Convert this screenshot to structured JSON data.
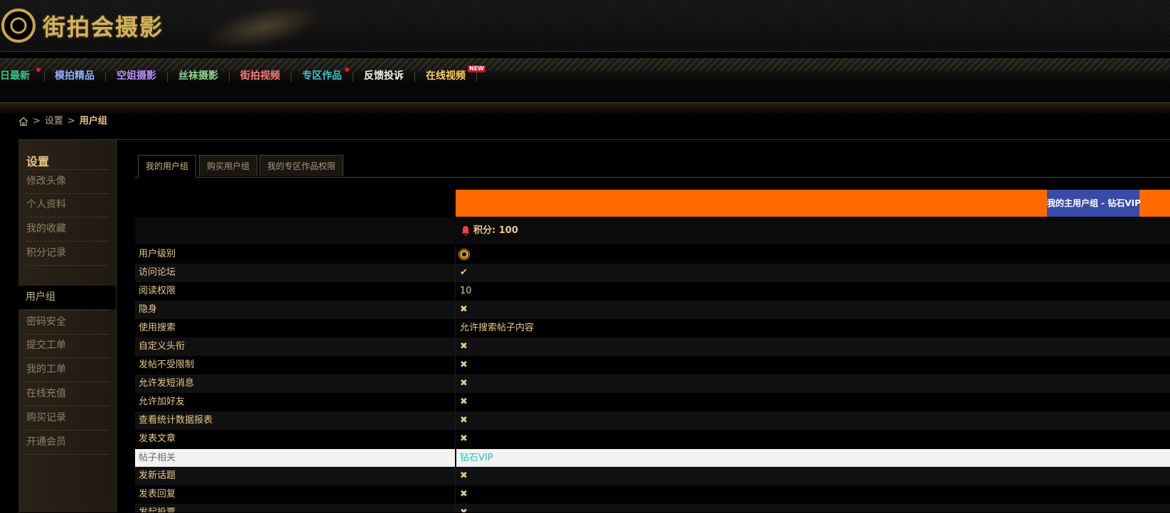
{
  "header": {
    "logo_text": "街拍会摄影"
  },
  "nav": {
    "items": [
      {
        "label": "今日最新",
        "color": "#33c98a"
      },
      {
        "label": "模拍精品",
        "color": "#8fb3ff"
      },
      {
        "label": "空姐摄影",
        "color": "#b88cff"
      },
      {
        "label": "丝袜摄影",
        "color": "#8fd48f"
      },
      {
        "label": "街拍视频",
        "color": "#ff7a7a"
      },
      {
        "label": "专区作品",
        "color": "#33c9c9"
      },
      {
        "label": "反馈投诉",
        "color": "#f0f0f0"
      },
      {
        "label": "在线视频",
        "color": "#ffd060"
      }
    ],
    "new_badge": "NEW"
  },
  "breadcrumb": {
    "home_icon": "home-icon",
    "sep": ">",
    "level1": "设置",
    "current": "用户组"
  },
  "sidebar": {
    "title": "设置",
    "items": [
      "修改头像",
      "个人资料",
      "我的收藏",
      "积分记录",
      "用户组",
      "密码安全",
      "提交工单",
      "我的工单",
      "在线充值",
      "购买记录",
      "开通会员"
    ],
    "active": "用户组"
  },
  "tabs": [
    "我的用户组",
    "购买用户组",
    "我的专区作品权限"
  ],
  "group": {
    "main_group_label": "我的主用户组 - 钻石VIP",
    "points_label": "积分: 100",
    "header_color": "#ff6a00",
    "badge_color": "#3a4aa8"
  },
  "rows": [
    {
      "label": "用户级别",
      "value": "",
      "icon": "sun-icon"
    },
    {
      "label": "访问论坛",
      "value": "",
      "icon": "check-icon"
    },
    {
      "label": "阅读权限",
      "value": "10",
      "icon": ""
    },
    {
      "label": "隐身",
      "value": "",
      "icon": "x-icon"
    },
    {
      "label": "使用搜索",
      "value": "允许搜索帖子内容",
      "icon": ""
    },
    {
      "label": "自定义头衔",
      "value": "",
      "icon": "x-icon"
    },
    {
      "label": "发帖不受限制",
      "value": "",
      "icon": "x-icon"
    },
    {
      "label": "允许发短消息",
      "value": "",
      "icon": "x-icon"
    },
    {
      "label": "允许加好友",
      "value": "",
      "icon": "x-icon"
    },
    {
      "label": "查看统计数据报表",
      "value": "",
      "icon": "x-icon"
    },
    {
      "label": "发表文章",
      "value": "",
      "icon": "x-icon"
    },
    {
      "label": "帖子相关",
      "value": "钻石VIP",
      "icon": ""
    },
    {
      "label": "发新话题",
      "value": "",
      "icon": "x-icon"
    },
    {
      "label": "发表回复",
      "value": "",
      "icon": "x-icon"
    },
    {
      "label": "发起投票",
      "value": "",
      "icon": "x-icon"
    }
  ]
}
